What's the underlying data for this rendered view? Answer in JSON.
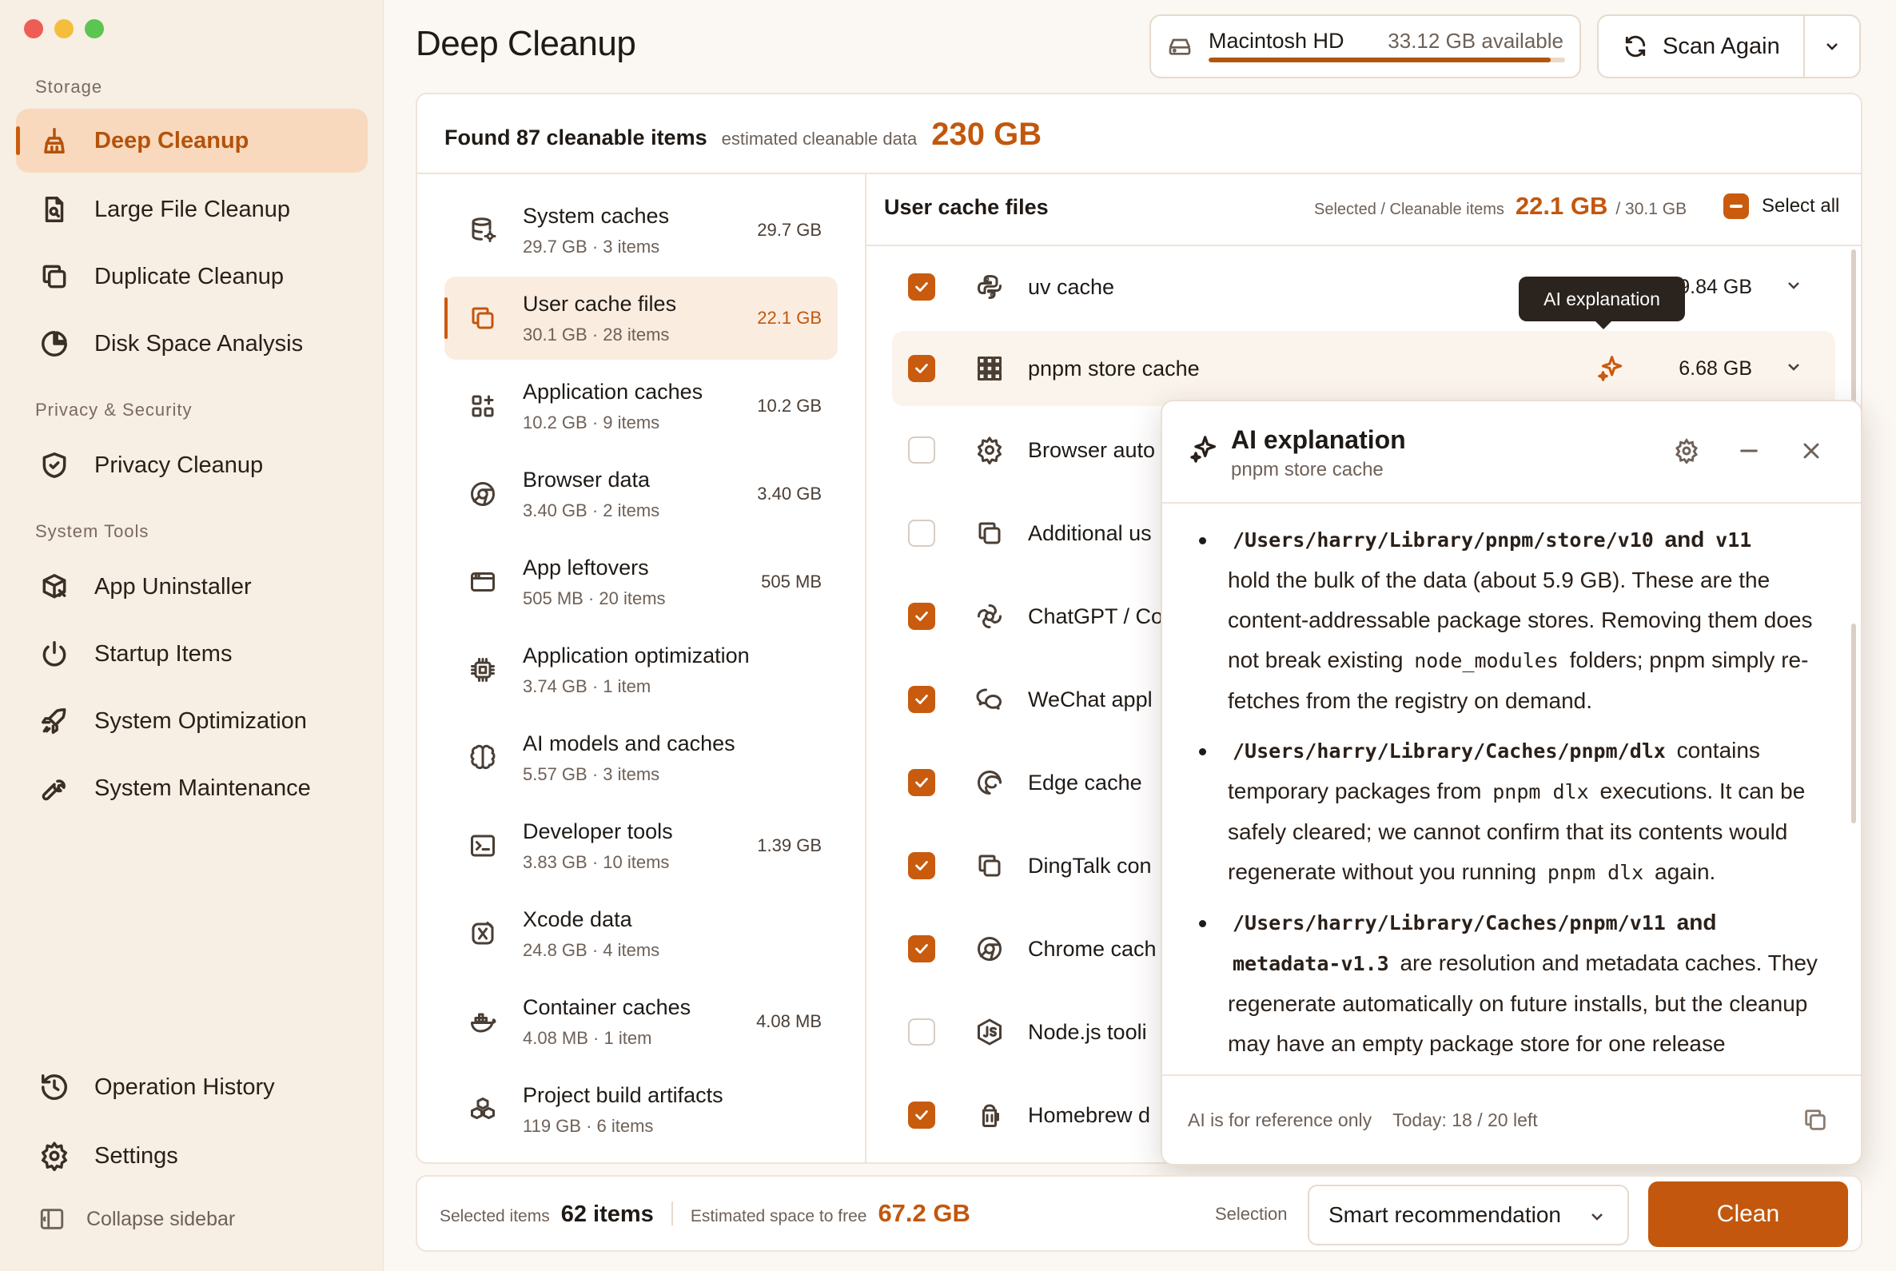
{
  "window": {
    "title": "Deep Cleanup"
  },
  "sidebar": {
    "sections": [
      {
        "title": "Storage"
      },
      {
        "title": "Privacy & Security"
      },
      {
        "title": "System Tools"
      }
    ],
    "items": [
      {
        "label": "Deep Cleanup",
        "icon": "broom-icon"
      },
      {
        "label": "Large File Cleanup",
        "icon": "file-search-icon"
      },
      {
        "label": "Duplicate Cleanup",
        "icon": "copy-icon"
      },
      {
        "label": "Disk Space Analysis",
        "icon": "pie-chart-icon"
      },
      {
        "label": "Privacy Cleanup",
        "icon": "shield-icon"
      },
      {
        "label": "App Uninstaller",
        "icon": "package-x-icon"
      },
      {
        "label": "Startup Items",
        "icon": "power-icon"
      },
      {
        "label": "System Optimization",
        "icon": "rocket-icon"
      },
      {
        "label": "System Maintenance",
        "icon": "wrench-icon"
      },
      {
        "label": "Operation History",
        "icon": "history-icon"
      },
      {
        "label": "Settings",
        "icon": "gear-icon"
      }
    ],
    "collapse_label": "Collapse sidebar"
  },
  "header": {
    "disk_name": "Macintosh HD",
    "disk_available": "33.12 GB available",
    "disk_used_fraction": 0.96,
    "scan_label": "Scan Again"
  },
  "summary": {
    "found": "Found 87 cleanable items",
    "estimated_label": "estimated cleanable data",
    "estimated_value": "230 GB"
  },
  "categories": [
    {
      "name": "System caches",
      "meta": "29.7 GB · 3 items",
      "size": "29.7 GB",
      "icon": "database-gear-icon"
    },
    {
      "name": "User cache files",
      "meta": "30.1 GB · 28 items",
      "size": "22.1 GB",
      "icon": "copy-icon"
    },
    {
      "name": "Application caches",
      "meta": "10.2 GB · 9 items",
      "size": "10.2 GB",
      "icon": "apps-plus-icon"
    },
    {
      "name": "Browser data",
      "meta": "3.40 GB · 2 items",
      "size": "3.40 GB",
      "icon": "browser-icon"
    },
    {
      "name": "App leftovers",
      "meta": "505 MB · 20 items",
      "size": "505 MB",
      "icon": "window-icon"
    },
    {
      "name": "Application optimization",
      "meta": "3.74 GB · 1 item",
      "size": "",
      "icon": "chip-icon"
    },
    {
      "name": "AI models and caches",
      "meta": "5.57 GB · 3 items",
      "size": "",
      "icon": "brain-icon"
    },
    {
      "name": "Developer tools",
      "meta": "3.83 GB · 10 items",
      "size": "1.39 GB",
      "icon": "terminal-icon"
    },
    {
      "name": "Xcode data",
      "meta": "24.8 GB · 4 items",
      "size": "",
      "icon": "xcode-icon"
    },
    {
      "name": "Container caches",
      "meta": "4.08 MB · 1 item",
      "size": "4.08 MB",
      "icon": "docker-icon"
    },
    {
      "name": "Project build artifacts",
      "meta": "119 GB · 6 items",
      "size": "",
      "icon": "boxes-icon"
    }
  ],
  "items_panel": {
    "title": "User cache files",
    "selected_label": "Selected / Cleanable items",
    "selected_value": "22.1 GB",
    "total_value": "/ 30.1 GB",
    "select_all": "Select all"
  },
  "items": [
    {
      "name": "uv cache",
      "size": "9.84 GB",
      "checked": true,
      "icon": "python-icon"
    },
    {
      "name": "pnpm store cache",
      "size": "6.68 GB",
      "checked": true,
      "icon": "pnpm-grid-icon"
    },
    {
      "name": "Browser auto",
      "size": "",
      "checked": false,
      "icon": "gear-icon"
    },
    {
      "name": "Additional us",
      "size": "",
      "checked": false,
      "icon": "copy-icon"
    },
    {
      "name": "ChatGPT / Co",
      "size": "",
      "checked": true,
      "icon": "openai-icon"
    },
    {
      "name": "WeChat appl",
      "size": "",
      "checked": true,
      "icon": "wechat-icon"
    },
    {
      "name": "Edge cache",
      "size": "",
      "checked": true,
      "icon": "edge-icon"
    },
    {
      "name": "DingTalk con",
      "size": "",
      "checked": true,
      "icon": "copy-icon"
    },
    {
      "name": "Chrome cach",
      "size": "",
      "checked": true,
      "icon": "chrome-icon"
    },
    {
      "name": "Node.js tooli",
      "size": "",
      "checked": false,
      "icon": "nodejs-icon"
    },
    {
      "name": "Homebrew d",
      "size": "",
      "checked": true,
      "icon": "homebrew-icon"
    }
  ],
  "tooltip": "AI explanation",
  "ai_panel": {
    "title": "AI explanation",
    "subtitle": "pnpm store cache",
    "b1_path": "/Users/harry/Library/pnpm/store/v10",
    "b1_and": "and",
    "b1_v11": "v11",
    "b1_text1": "hold the bulk of the data (about 5.9 GB). These are the content-addressable package stores. Removing them does not break existing",
    "b1_code": "node_modules",
    "b1_text2": "folders; pnpm simply re-fetches from the registry on demand.",
    "b2_path": "/Users/harry/Library/Caches/pnpm/dlx",
    "b2_text1": "contains temporary packages from",
    "b2_code": "pnpm dlx",
    "b2_text2": "executions. It can be safely cleared; we cannot confirm that its contents would regenerate without you running",
    "b2_code2": "pnpm dlx",
    "b2_text3": "again.",
    "b3_path": "/Users/harry/Library/Caches/pnpm/v11",
    "b3_and": "and",
    "b3_meta": "metadata-v1.3",
    "b3_text": "are resolution and metadata caches. They regenerate automatically on future installs, but the cleanup may have an empty package store for one release",
    "footer_note": "AI is for reference only",
    "footer_quota": "Today: 18 / 20 left"
  },
  "bottom_bar": {
    "selected_label": "Selected items",
    "selected_value": "62 items",
    "space_label": "Estimated space to free",
    "space_value": "67.2 GB",
    "selection_label": "Selection",
    "selection_value": "Smart recommendation",
    "clean_label": "Clean"
  },
  "colors": {
    "accent": "#c95b0e",
    "sidebar_bg": "#f7eee4",
    "active_bg": "#f8d9bd"
  }
}
